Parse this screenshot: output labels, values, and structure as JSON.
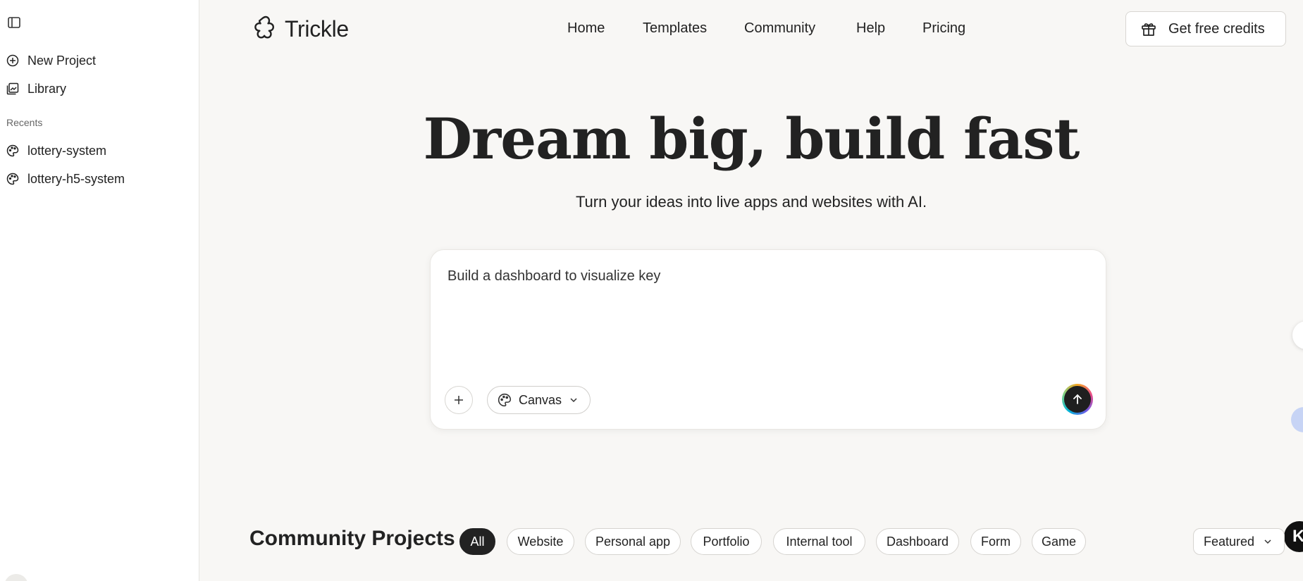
{
  "sidebar": {
    "new_project": "New Project",
    "library": "Library",
    "recents_label": "Recents",
    "recents": [
      "lottery-system",
      "lottery-h5-system"
    ]
  },
  "header": {
    "logo": "Trickle",
    "nav": [
      "Home",
      "Templates",
      "Community",
      "Help",
      "Pricing"
    ],
    "credits_button": "Get free credits"
  },
  "hero": {
    "title": "Dream big, build fast",
    "subtitle": "Turn your ideas into live apps and websites with AI."
  },
  "prompt": {
    "value": "Build a dashboard to visualize key",
    "mode": "Canvas"
  },
  "community": {
    "title": "Community Projects",
    "filters": [
      "All",
      "Website",
      "Personal app",
      "Portfolio",
      "Internal tool",
      "Dashboard",
      "Form",
      "Game"
    ],
    "active_filter": "All",
    "sort": "Featured"
  },
  "edge": {
    "k_label": "K"
  }
}
